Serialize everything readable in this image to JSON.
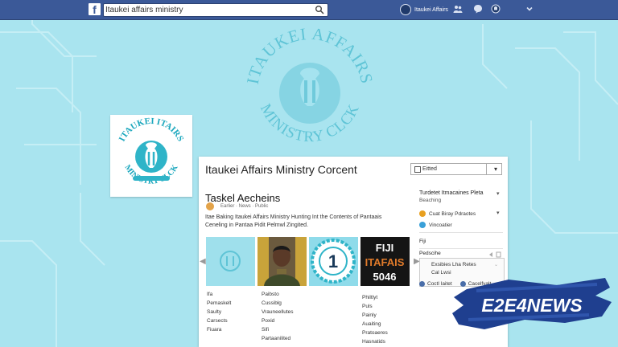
{
  "topbar": {
    "logo_text": "f",
    "search": {
      "value": "Itaukei affairs ministry"
    },
    "profile_name": "Itaukei Affairs",
    "icons": [
      "friends-icon",
      "messenger-icon",
      "notifications-icon",
      "account-menu-icon"
    ]
  },
  "background": {
    "watermark_text_top": "ITAUKEI AFFAIRS",
    "watermark_text_bottom": "MINISTRY CLCK"
  },
  "logo_card": {
    "text_top": "ITAUKEI ITAIRS",
    "text_bottom": "MINISTRY CLCK"
  },
  "panel": {
    "title": "Itaukei Affairs Ministry Corcent",
    "dropdown": {
      "value": "Eitted"
    },
    "post": {
      "heading": "Taskel Aecheins",
      "meta": "Earlier · News · Public",
      "text_line1": "Itae Baking Itaukei Affairs Ministry Hunting Int the Contents of Pantaais",
      "text_line2": "Ceneling in Pantaa Pidit Pelmwl Zingited."
    },
    "gallery": {
      "thumb4_line1": "FIJI",
      "thumb4_line2": "ITAFAIS",
      "thumb4_line3": "5046",
      "thumb3_text": "1",
      "arrow_left": "◀",
      "arrow_right": "▶"
    },
    "list1": [
      "Ifa",
      "Pemaskelt",
      "Saulty",
      "Carsects",
      "Fiuara"
    ],
    "list2": [
      "Paibsto",
      "Cussiblg",
      "Vrauneellutes",
      "Poxid",
      "Sifi",
      "Partaanilited"
    ],
    "list3": [
      "Philtlyt",
      "Puls",
      "Painly",
      "Auaiting",
      "Pratoaeres",
      "Hasnatids"
    ]
  },
  "sidebar": {
    "header": "Turdetet Itmacaines Pleta",
    "header_sub": "Beaching",
    "rows": [
      "Cuat Biray Pdraotes",
      "Vincoatier"
    ],
    "label_fiji": "Fiji",
    "label_subscribe": "Pedscihe",
    "box_line1": "Exsibies Lha Retes",
    "box_line2": "Cal Lwsi",
    "bottom_left": "Coctl Iaitet",
    "bottom_right": "Cacelfvalt"
  },
  "news_logo": {
    "text": "E2E4NEWS"
  },
  "colors": {
    "topbar": "#3b5998",
    "background": "#a9e4ef",
    "watermark": "#5fc4d6",
    "emblem": "#2fb4c8",
    "news_logo": "#1f3f8f"
  }
}
